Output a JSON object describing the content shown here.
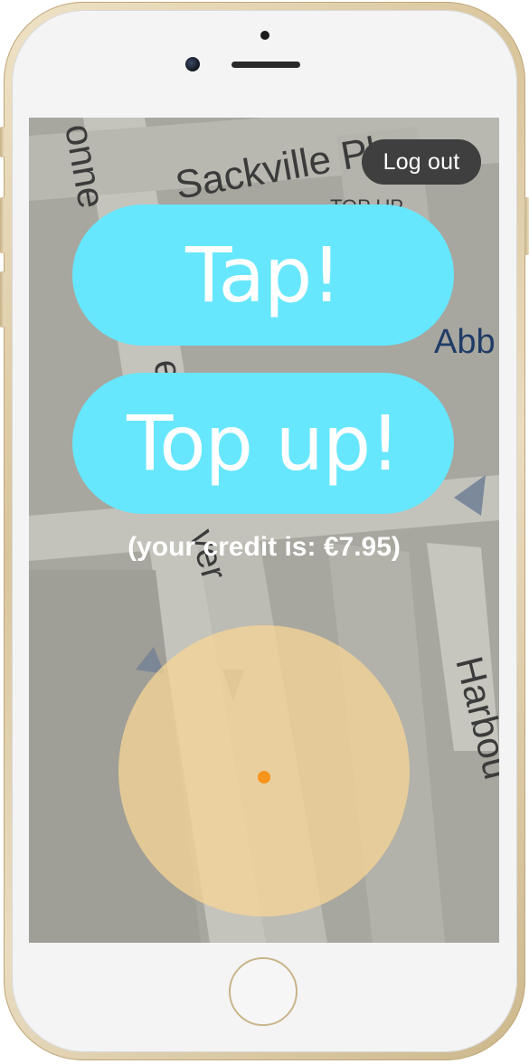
{
  "map": {
    "street_sackville": "Sackville Pl",
    "street_harbour": "Harbou",
    "street_left_vertical": "onne",
    "street_river_fragment": "ver",
    "street_e_fragment": "e",
    "label_abb": "Abb",
    "label_top_up": "TOP UP"
  },
  "header": {
    "logout_label": "Log out"
  },
  "actions": {
    "tap_label": "Tap!",
    "topup_label": "Top up!"
  },
  "credit": {
    "text": "(your credit is: €7.95)"
  },
  "location": {
    "icon": "user-location-dot",
    "accuracy_color": "#f7d696",
    "dot_color": "#f7941d"
  },
  "colors": {
    "button_bg": "#67e7fd",
    "logout_bg": "#3f3f3f"
  }
}
